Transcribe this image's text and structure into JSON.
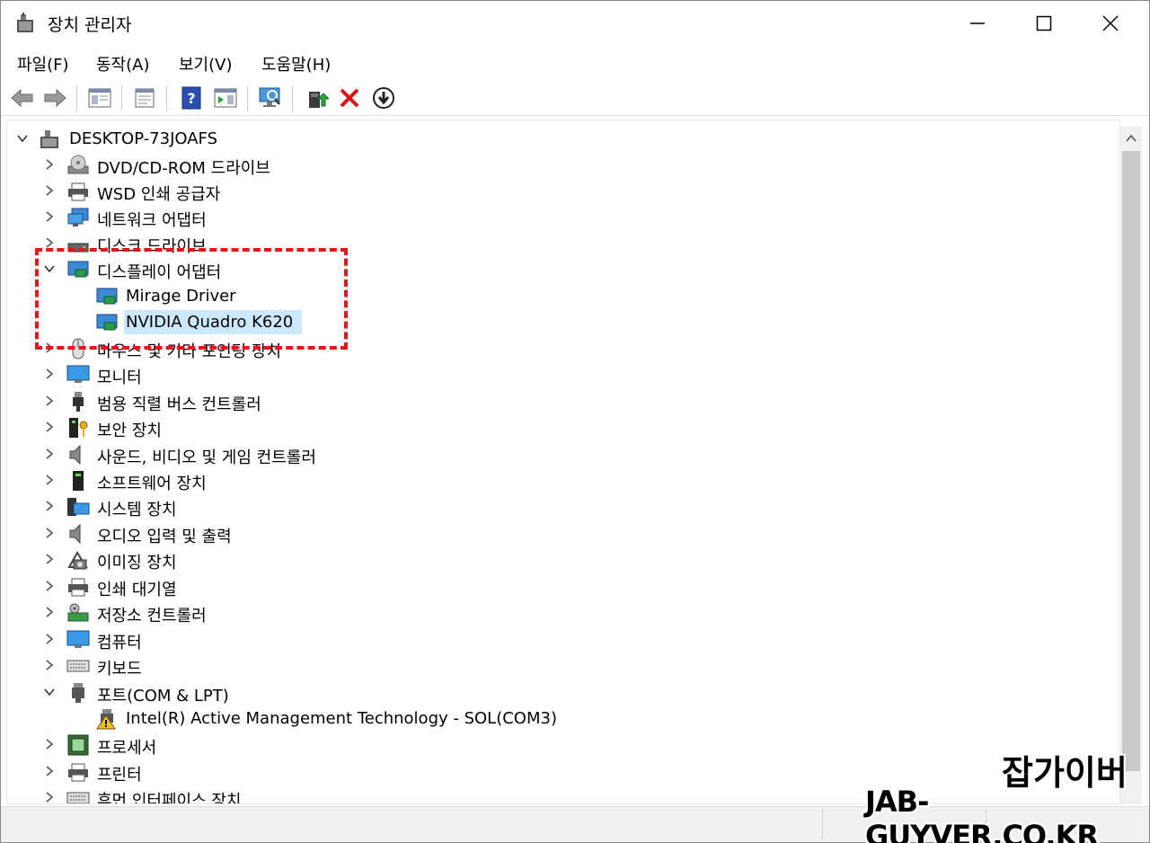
{
  "window": {
    "title": "장치 관리자"
  },
  "menu": [
    {
      "label": "파일(F)"
    },
    {
      "label": "동작(A)"
    },
    {
      "label": "보기(V)"
    },
    {
      "label": "도움말(H)"
    }
  ],
  "toolbar": {
    "buttons": [
      {
        "icon": "back-arrow-icon"
      },
      {
        "icon": "forward-arrow-icon"
      },
      {
        "icon": "show-hide-console-tree-icon"
      },
      {
        "icon": "properties-icon"
      },
      {
        "icon": "help-icon"
      },
      {
        "icon": "show-hide-action-pane-icon"
      },
      {
        "icon": "scan-hardware-changes-icon"
      },
      {
        "icon": "update-driver-icon"
      },
      {
        "icon": "uninstall-device-icon"
      },
      {
        "icon": "disable-device-icon"
      }
    ]
  },
  "tree": {
    "root": "DESKTOP-73JOAFS",
    "items": [
      {
        "label": "DVD/CD-ROM 드라이브",
        "expanded": false
      },
      {
        "label": "WSD 인쇄 공급자",
        "expanded": false
      },
      {
        "label": "네트워크 어댑터",
        "expanded": false
      },
      {
        "label": "디스크 드라이브",
        "expanded": false
      },
      {
        "label": "디스플레이 어댑터",
        "expanded": true
      },
      {
        "label": "Mirage Driver",
        "child": true
      },
      {
        "label": "NVIDIA Quadro K620",
        "child": true,
        "selected": true
      },
      {
        "label": "마우스 및 기타 포인팅 장치",
        "expanded": false
      },
      {
        "label": "모니터",
        "expanded": false
      },
      {
        "label": "범용 직렬 버스 컨트롤러",
        "expanded": false
      },
      {
        "label": "보안 장치",
        "expanded": false
      },
      {
        "label": "사운드, 비디오 및 게임 컨트롤러",
        "expanded": false
      },
      {
        "label": "소프트웨어 장치",
        "expanded": false
      },
      {
        "label": "시스템 장치",
        "expanded": false
      },
      {
        "label": "오디오 입력 및 출력",
        "expanded": false
      },
      {
        "label": "이미징 장치",
        "expanded": false
      },
      {
        "label": "인쇄 대기열",
        "expanded": false
      },
      {
        "label": "저장소 컨트롤러",
        "expanded": false
      },
      {
        "label": "컴퓨터",
        "expanded": false
      },
      {
        "label": "키보드",
        "expanded": false
      },
      {
        "label": "포트(COM & LPT)",
        "expanded": true
      },
      {
        "label": "Intel(R) Active Management Technology - SOL(COM3)",
        "child": true,
        "warning": true
      },
      {
        "label": "프로세서",
        "expanded": false
      },
      {
        "label": "프린터",
        "expanded": false
      },
      {
        "label": "휴먼 인터페이스 장치",
        "expanded": false
      }
    ]
  },
  "watermark": {
    "korean": "잡가이버",
    "english": "JAB-GUYVER.CO.KR"
  },
  "colors": {
    "selection": "#cce8ff",
    "highlight_border": "#e01818"
  }
}
